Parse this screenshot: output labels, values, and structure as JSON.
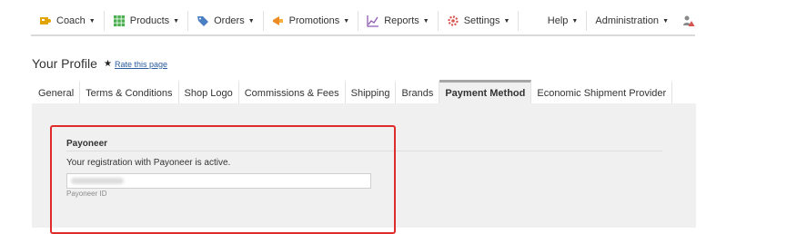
{
  "nav": {
    "items": [
      {
        "label": "Coach",
        "icon": "coach-icon",
        "color": "#e2a400"
      },
      {
        "label": "Products",
        "icon": "grid-icon",
        "color": "#4caf50"
      },
      {
        "label": "Orders",
        "icon": "tag-icon",
        "color": "#4a7fc1"
      },
      {
        "label": "Promotions",
        "icon": "megaphone-icon",
        "color": "#f08a24"
      },
      {
        "label": "Reports",
        "icon": "chart-icon",
        "color": "#8e5bb5"
      },
      {
        "label": "Settings",
        "icon": "gear-icon",
        "color": "#d9534f"
      }
    ],
    "right": [
      {
        "label": "Help"
      },
      {
        "label": "Administration"
      }
    ],
    "alert_icon": "user-alert-icon"
  },
  "page": {
    "title": "Your Profile",
    "rate_label": "Rate this page"
  },
  "tabs": [
    {
      "label": "General",
      "active": false
    },
    {
      "label": "Terms & Conditions",
      "active": false
    },
    {
      "label": "Shop Logo",
      "active": false
    },
    {
      "label": "Commissions & Fees",
      "active": false
    },
    {
      "label": "Shipping",
      "active": false
    },
    {
      "label": "Brands",
      "active": false
    },
    {
      "label": "Payment Method",
      "active": true
    },
    {
      "label": "Economic Shipment Provider",
      "active": false
    }
  ],
  "payoneer": {
    "section_title": "Payoneer",
    "status": "Your registration with Payoneer is active.",
    "id_value": "",
    "id_label": "Payoneer ID"
  },
  "colors": {
    "highlight": "#e02b2b",
    "panel_bg": "#f0f0f0"
  }
}
